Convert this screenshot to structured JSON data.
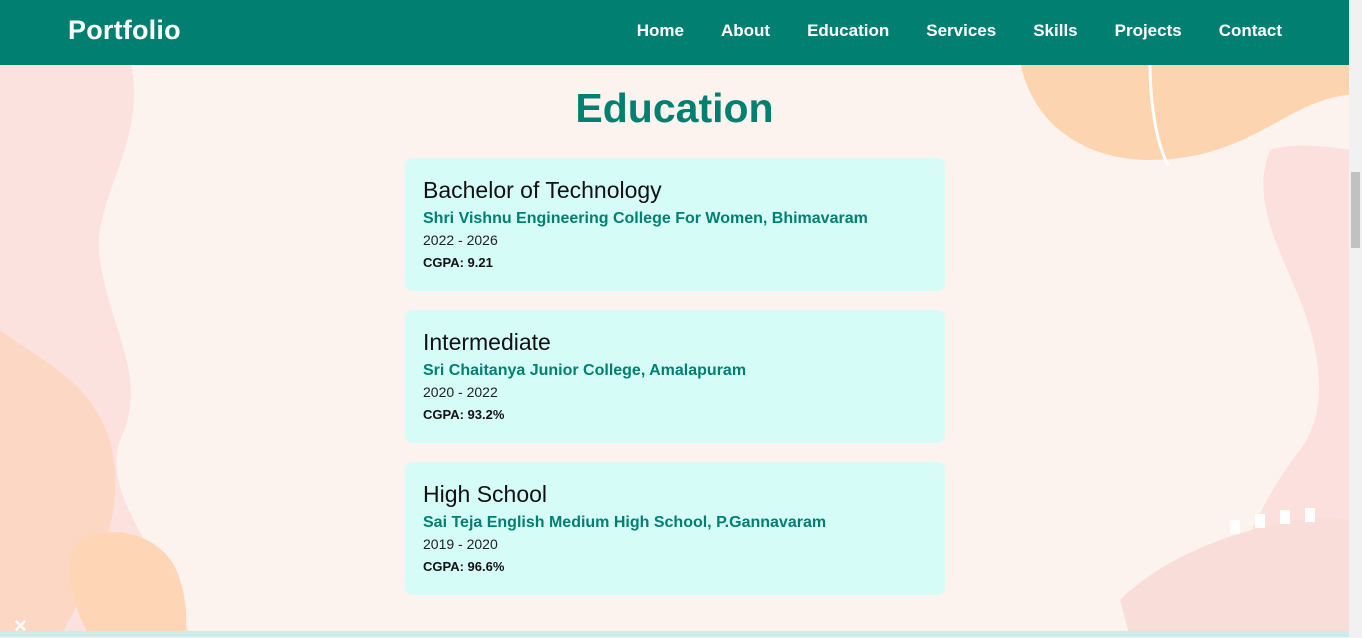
{
  "header": {
    "brand": "Portfolio",
    "nav": [
      "Home",
      "About",
      "Education",
      "Services",
      "Skills",
      "Projects",
      "Contact"
    ]
  },
  "education": {
    "title": "Education",
    "items": [
      {
        "degree": "Bachelor of Technology",
        "school": "Shri Vishnu Engineering College For Women, Bhimavaram",
        "years": "2022 - 2026",
        "score": "CGPA: 9.21"
      },
      {
        "degree": "Intermediate",
        "school": "Sri Chaitanya Junior College, Amalapuram",
        "years": "2020 - 2022",
        "score": "CGPA: 93.2%"
      },
      {
        "degree": "High School",
        "school": "Sai Teja English Medium High School, P.Gannavaram",
        "years": "2019 - 2020",
        "score": "CGPA: 96.6%"
      }
    ]
  },
  "theme": {
    "primary": "#017f70",
    "card_bg": "#d6fcf8",
    "page_bg": "#fdf3ee"
  },
  "close_icon": "close-icon",
  "close_glyph": "×"
}
